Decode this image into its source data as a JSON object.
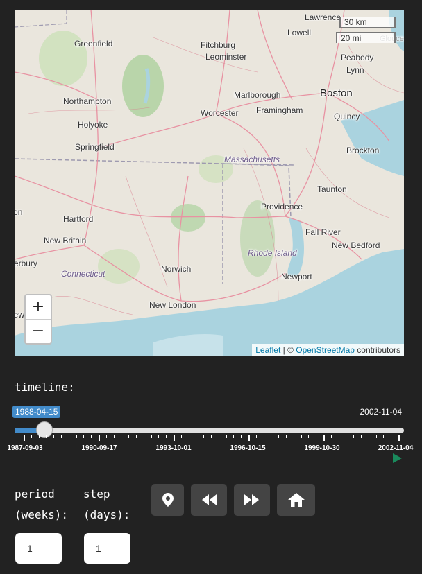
{
  "map": {
    "places": [
      {
        "name": "Lawrence",
        "cls": ""
      },
      {
        "name": "Lowell",
        "cls": ""
      },
      {
        "name": "Greenfield",
        "cls": ""
      },
      {
        "name": "Fitchburg",
        "cls": ""
      },
      {
        "name": "Leominster",
        "cls": ""
      },
      {
        "name": "Peabody",
        "cls": ""
      },
      {
        "name": "Lynn",
        "cls": ""
      },
      {
        "name": "Gloucester",
        "cls": ""
      },
      {
        "name": "Northampton",
        "cls": ""
      },
      {
        "name": "Marlborough",
        "cls": ""
      },
      {
        "name": "Boston",
        "cls": "big"
      },
      {
        "name": "Worcester",
        "cls": ""
      },
      {
        "name": "Framingham",
        "cls": ""
      },
      {
        "name": "Quincy",
        "cls": ""
      },
      {
        "name": "Holyoke",
        "cls": ""
      },
      {
        "name": "Springfield",
        "cls": ""
      },
      {
        "name": "Brockton",
        "cls": ""
      },
      {
        "name": "Massachusetts",
        "cls": "state"
      },
      {
        "name": "Taunton",
        "cls": ""
      },
      {
        "name": "Providence",
        "cls": ""
      },
      {
        "name": "Hartford",
        "cls": ""
      },
      {
        "name": "Fall River",
        "cls": ""
      },
      {
        "name": "New Britain",
        "cls": ""
      },
      {
        "name": "New Bedford",
        "cls": ""
      },
      {
        "name": "Rhode Island",
        "cls": "state"
      },
      {
        "name": "Waterbury",
        "cls": ""
      },
      {
        "name": "Norwich",
        "cls": ""
      },
      {
        "name": "Connecticut",
        "cls": "state"
      },
      {
        "name": "Newport",
        "cls": ""
      },
      {
        "name": "New London",
        "cls": ""
      },
      {
        "name": "New Haven",
        "cls": ""
      },
      {
        "name": "Torrington",
        "cls": ""
      }
    ],
    "scale_km": "30 km",
    "scale_mi": "20 mi",
    "zoom_in": "+",
    "zoom_out": "−",
    "attribution": {
      "leaflet": "Leaflet",
      "sep": " | © ",
      "osm": "OpenStreetMap",
      "suffix": " contributors"
    },
    "colors": {
      "water": "#aad3df",
      "land": "#eae6dd",
      "forest": "#add19e",
      "road": "#e892a2",
      "motorway": "#e07a8d",
      "boundary": "#9e9ab0"
    }
  },
  "timeline": {
    "label": "timeline:",
    "current": "1988-04-15",
    "max": "2002-11-04",
    "position_fraction": 0.055,
    "tick_labels": [
      "1987-09-03",
      "1990-09-17",
      "1993-10-01",
      "1996-10-15",
      "1999-10-30",
      "2002-11-04"
    ],
    "play_icon": "play-icon"
  },
  "controls": {
    "period_label_1": "period",
    "period_label_2": "(weeks):",
    "step_label_1": "step",
    "step_label_2": "(days):",
    "period_value": "1",
    "step_value": "1",
    "buttons": [
      "location-pin-icon",
      "rewind-icon",
      "fast-forward-icon",
      "home-icon"
    ],
    "accent": "#428bca"
  }
}
